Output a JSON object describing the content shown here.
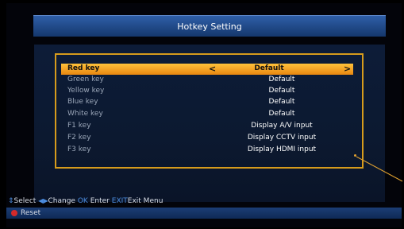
{
  "header": {
    "title": "Hotkey Setting"
  },
  "hotkeys": [
    {
      "label": "Red key",
      "value": "Default",
      "selected": true
    },
    {
      "label": "Green key",
      "value": "Default"
    },
    {
      "label": "Yellow key",
      "value": "Default"
    },
    {
      "label": "Blue key",
      "value": "Default"
    },
    {
      "label": "White key",
      "value": "Default"
    },
    {
      "label": "F1 key",
      "value": "Display A/V input"
    },
    {
      "label": "F2 key",
      "value": "Display CCTV input"
    },
    {
      "label": "F3 key",
      "value": "Display HDMI input"
    }
  ],
  "selector": {
    "left_arrow": "<",
    "right_arrow": ">"
  },
  "help": {
    "select_icon": "⇕",
    "select_label": "Select",
    "change_icon": "◀▶",
    "change_label": "Change",
    "ok_key": "OK",
    "ok_label": "Enter",
    "exit_key": "EXIT",
    "exit_label": "Exit Menu"
  },
  "footer": {
    "reset_label": "Reset",
    "reset_color": "#d42a2a"
  },
  "colors": {
    "accent": "#d69b1c",
    "title_bar": "#2f5fa8"
  }
}
